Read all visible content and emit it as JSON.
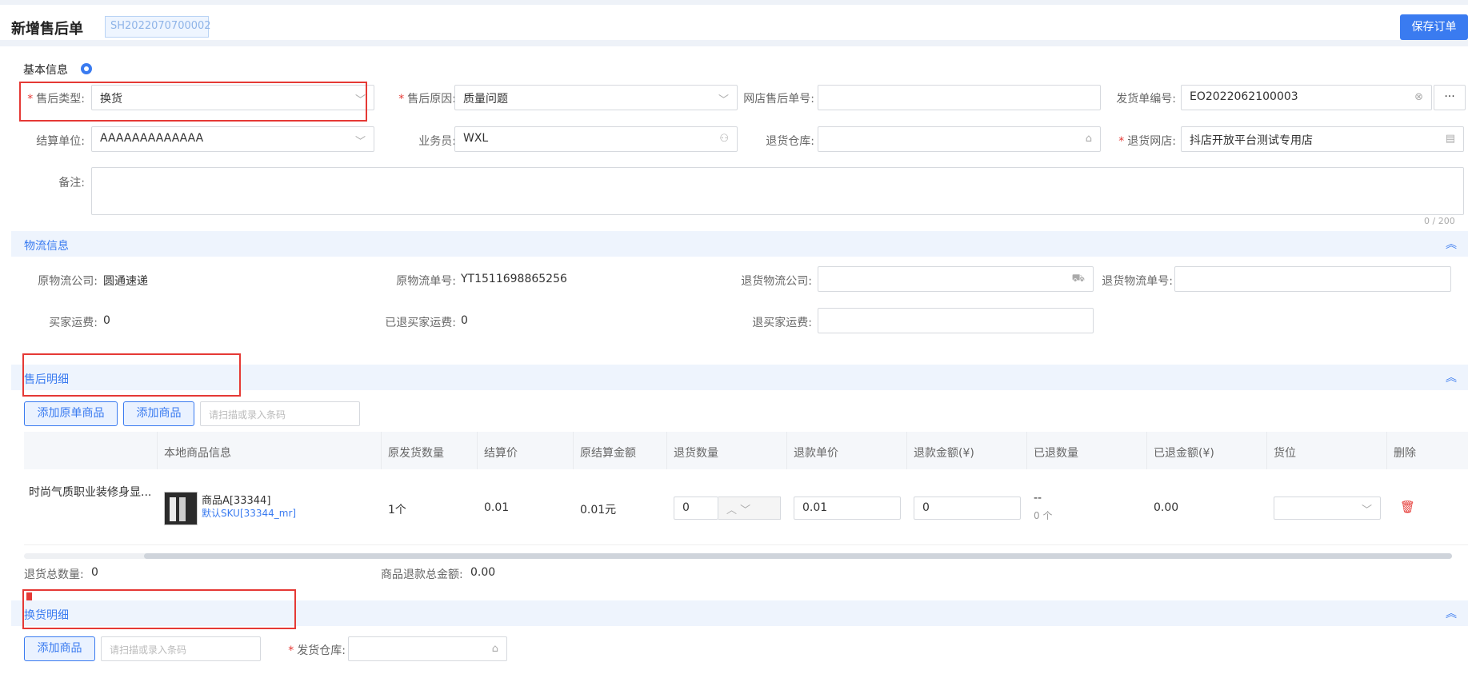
{
  "header": {
    "title": "新增售后单",
    "order_no": "SH2022070700002",
    "save_label": "保存订单"
  },
  "basic": {
    "section_title": "基本信息",
    "aftersale_type": {
      "label": "售后类型:",
      "value": "换货"
    },
    "aftersale_reason": {
      "label": "售后原因:",
      "value": "质量问题"
    },
    "shop_aftersale_no": {
      "label": "网店售后单号:",
      "value": ""
    },
    "delivery_no": {
      "label": "发货单编号:",
      "value": "EO2022062100003"
    },
    "settle_unit": {
      "label": "结算单位:",
      "value": "AAAAAAAAAAAAA"
    },
    "salesman": {
      "label": "业务员:",
      "value": "WXL"
    },
    "return_warehouse": {
      "label": "退货仓库:",
      "value": ""
    },
    "return_shop": {
      "label": "退货网店:",
      "value": "抖店开放平台测试专用店"
    },
    "remark": {
      "label": "备注:",
      "counter": "0 / 200"
    }
  },
  "logistics": {
    "title": "物流信息",
    "orig_company_label": "原物流公司:",
    "orig_company_value": "圆通速递",
    "orig_tracking_label": "原物流单号:",
    "orig_tracking_value": "YT1511698865256",
    "return_company_label": "退货物流公司:",
    "return_tracking_label": "退货物流单号:",
    "buyer_freight_label": "买家运费:",
    "buyer_freight_value": "0",
    "refunded_freight_label": "已退买家运费:",
    "refunded_freight_value": "0",
    "refund_freight_label": "退买家运费:"
  },
  "aftersale_detail": {
    "title": "售后明细",
    "add_orig_btn": "添加原单商品",
    "add_goods_btn": "添加商品",
    "scan_placeholder": "请扫描或录入条码",
    "columns": [
      "本地商品信息",
      "原发货数量",
      "结算价",
      "原结算金额",
      "退货数量",
      "退款单价",
      "退款金额(¥)",
      "已退数量",
      "已退金额(¥)",
      "货位",
      "删除"
    ],
    "row": {
      "platform_name": "时尚气质职业装修身显...",
      "goods_name": "商品A[33344]",
      "sku": "默认SKU[33344_mr]",
      "orig_qty": "1个",
      "settle_price": "0.01",
      "orig_amount": "0.01元",
      "return_qty": "0",
      "refund_price": "0.01",
      "refund_amount": "0",
      "returned_qty_main": "--",
      "returned_qty_sub": "0 个",
      "returned_amount": "0.00"
    },
    "total_qty_label": "退货总数量:",
    "total_qty_value": "0",
    "total_refund_label": "商品退款总金额:",
    "total_refund_value": "0.00"
  },
  "exchange_detail": {
    "title": "换货明细",
    "add_goods_btn": "添加商品",
    "scan_placeholder": "请扫描或录入条码",
    "ship_warehouse_label": "发货仓库:"
  },
  "colors": {
    "accent": "#3a7bf0",
    "danger": "#e53935",
    "band": "#eef4fd"
  }
}
